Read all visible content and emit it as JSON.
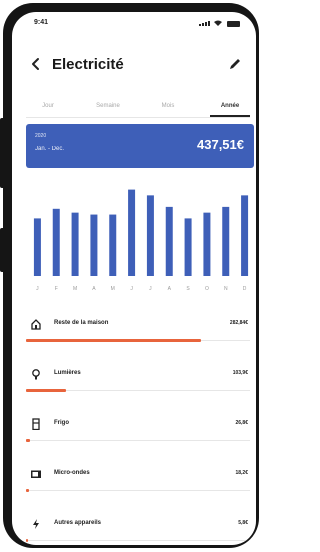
{
  "status_bar": {
    "time": "9:41"
  },
  "header": {
    "title": "Electricité"
  },
  "tabs": [
    {
      "label": "Jour",
      "active": false
    },
    {
      "label": "Semaine",
      "active": false
    },
    {
      "label": "Mois",
      "active": false
    },
    {
      "label": "Année",
      "active": true
    }
  ],
  "summary": {
    "year": "2020",
    "range": "Jan. - Dec.",
    "amount": "437,51€"
  },
  "chart_data": {
    "type": "bar",
    "categories": [
      "J",
      "F",
      "M",
      "A",
      "M",
      "J",
      "J",
      "A",
      "S",
      "O",
      "N",
      "D"
    ],
    "values": [
      30,
      35,
      33,
      32,
      32,
      45,
      42,
      36,
      30,
      33,
      36,
      42
    ],
    "ylim": [
      0,
      50
    ],
    "color": "#3e5fb8"
  },
  "categories": [
    {
      "name": "Reste de la maison",
      "value": "282,84€",
      "icon": "house-icon",
      "fraction": 0.78
    },
    {
      "name": "Lumières",
      "value": "103,9€",
      "icon": "lightbulb-icon",
      "fraction": 0.18
    },
    {
      "name": "Frigo",
      "value": "26,8€",
      "icon": "fridge-icon",
      "fraction": 0.02
    },
    {
      "name": "Micro-ondes",
      "value": "18,2€",
      "icon": "microwave-icon",
      "fraction": 0.015
    },
    {
      "name": "Autres appareils",
      "value": "5,8€",
      "icon": "lightning-icon",
      "fraction": 0.01
    }
  ],
  "colors": {
    "accent": "#3e5fb8",
    "bar_fill": "#e8643c",
    "text": "#222222"
  }
}
